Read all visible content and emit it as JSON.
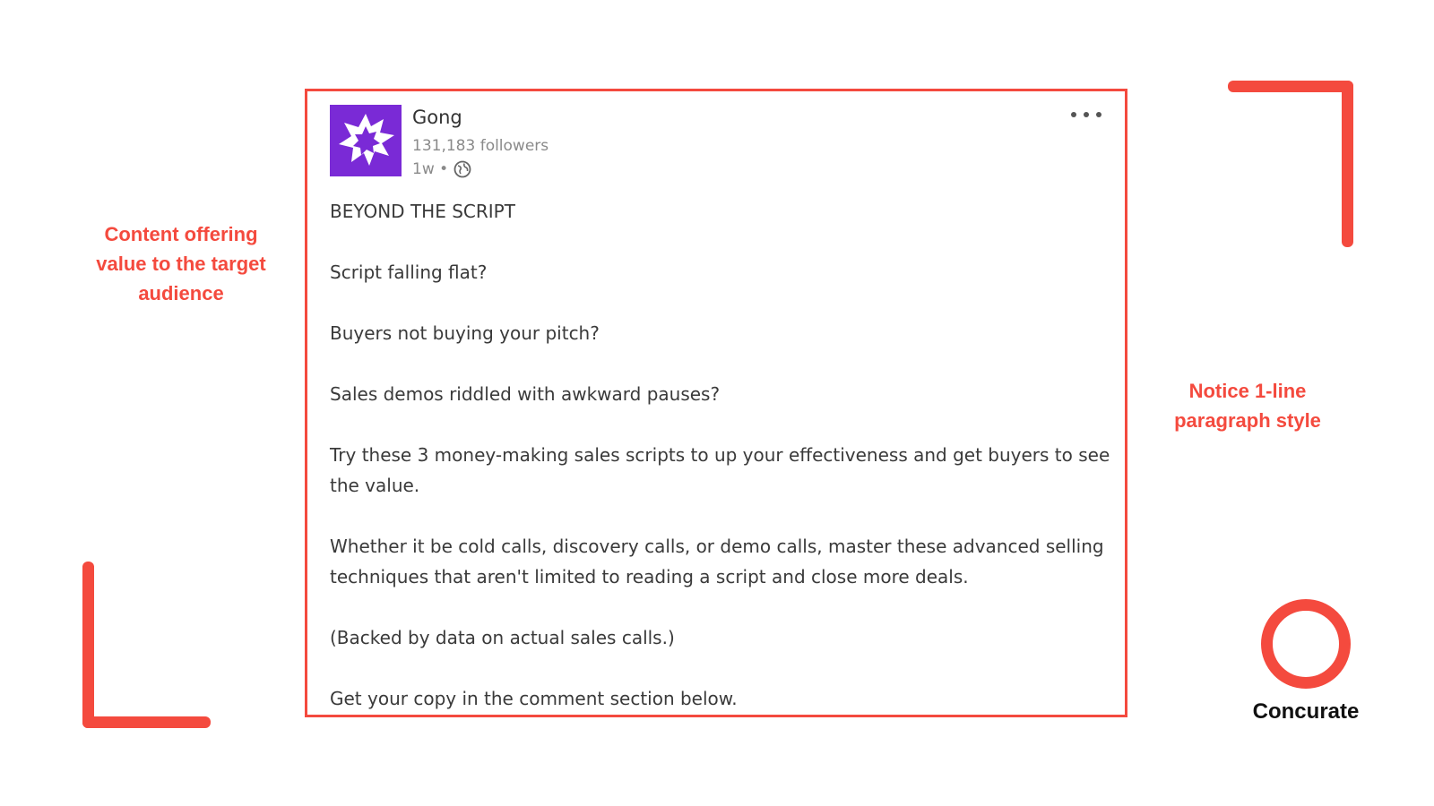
{
  "annotations": {
    "left": [
      "Content offering",
      "value to the target",
      "audience"
    ],
    "right": [
      "Notice 1-line",
      "paragraph style"
    ]
  },
  "post": {
    "author": "Gong",
    "followers": "131,183 followers",
    "age": "1w •",
    "visibility_icon": "globe-icon",
    "menu_icon": "ellipsis-icon",
    "paragraphs": [
      "BEYOND THE SCRIPT",
      "Script falling flat?",
      "Buyers not buying your pitch?",
      "Sales demos riddled with awkward pauses?",
      "Try these 3 money-making sales scripts to up your effectiveness and get buyers to see the value.",
      "Whether it be cold calls, discovery calls, or demo calls, master these advanced selling techniques that aren't limited to reading a script and close more deals.",
      "(Backed by data on actual sales calls.)",
      "Get your copy in the comment section below."
    ]
  },
  "brand": {
    "name": "Concurate"
  },
  "colors": {
    "accent": "#f44a3e",
    "avatar_bg": "#7a2ad6"
  }
}
